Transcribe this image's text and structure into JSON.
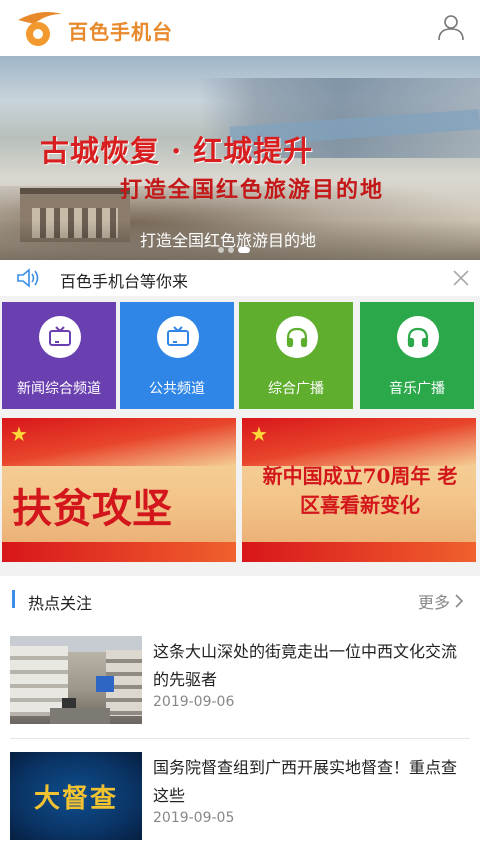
{
  "header": {
    "app_title": "百色手机台",
    "logo_icon": "sun-logo-icon",
    "user_icon": "user-icon",
    "brand_color": "#e8892b"
  },
  "banner": {
    "headline": "古城恢复 · 红城提升",
    "subhead": "打造全国红色旅游目的地",
    "caption": "打造全国红色旅游目的地",
    "slide_count": 3,
    "active_slide": 3
  },
  "notice": {
    "icon": "speaker-icon",
    "text": "百色手机台等你来",
    "close_icon": "close-icon"
  },
  "channels": [
    {
      "label": "新闻综合频道",
      "icon": "tv-icon",
      "color": "#6a3fb0"
    },
    {
      "label": "公共频道",
      "icon": "tv-icon",
      "color": "#2f86e6"
    },
    {
      "label": "综合广播",
      "icon": "headphones-icon",
      "color": "#5fae2e"
    },
    {
      "label": "音乐广播",
      "icon": "headphones-icon",
      "color": "#2ba84a"
    }
  ],
  "promos": [
    {
      "title": "扶贫攻坚"
    },
    {
      "title": "新中国成立70周年 老区喜看新变化"
    }
  ],
  "hot": {
    "title": "热点关注",
    "more": "更多",
    "accent": "#3a8ee6",
    "items": [
      {
        "title": "这条大山深处的街竟走出一位中西文化交流的先驱者",
        "date": "2019-09-06"
      },
      {
        "title": "国务院督查组到广西开展实地督查！重点查这些",
        "date": "2019-09-05",
        "thumb_text": "大督查"
      }
    ]
  }
}
